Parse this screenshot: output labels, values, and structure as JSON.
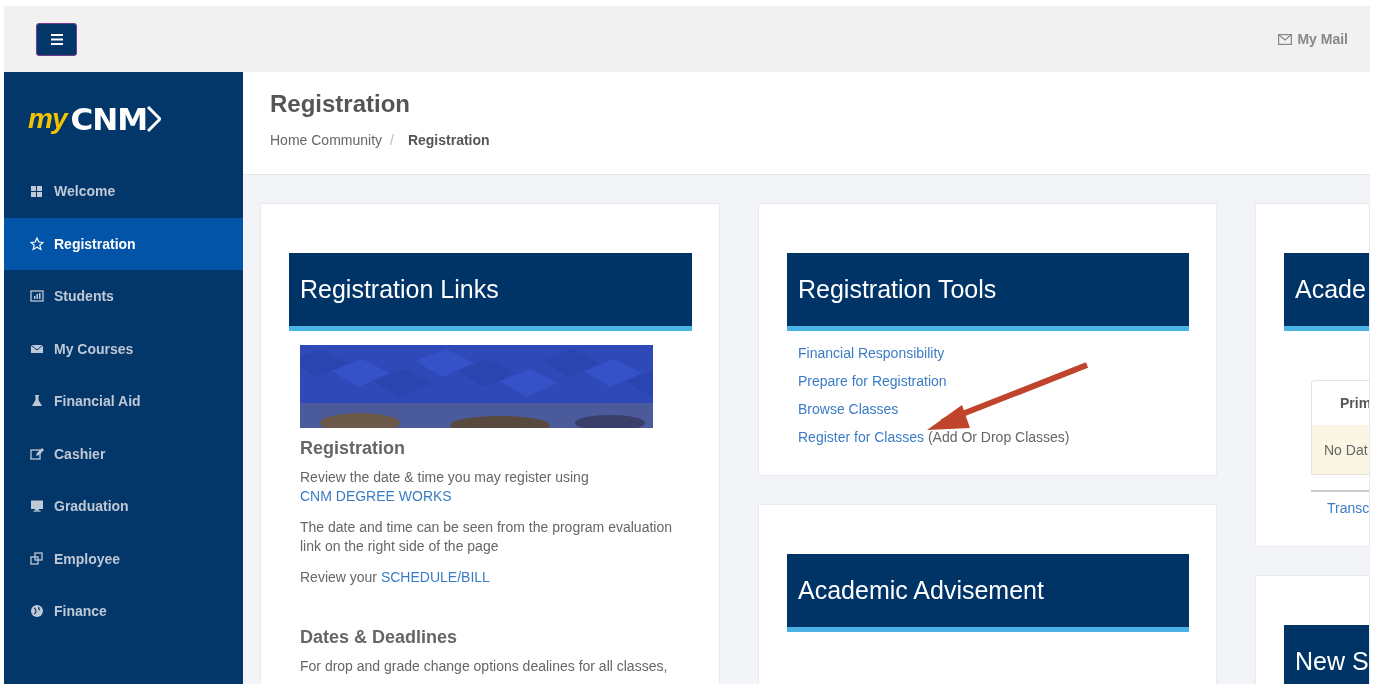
{
  "top_bar": {
    "mail_link": "My Mail"
  },
  "sidebar": {
    "logo": {
      "prefix": "my",
      "name": "CNM"
    },
    "items": [
      {
        "label": "Welcome",
        "selected": false
      },
      {
        "label": "Registration",
        "selected": true
      },
      {
        "label": "Students",
        "selected": false
      },
      {
        "label": "My Courses",
        "selected": false
      },
      {
        "label": "Financial Aid",
        "selected": false
      },
      {
        "label": "Cashier",
        "selected": false
      },
      {
        "label": "Graduation",
        "selected": false
      },
      {
        "label": "Employee",
        "selected": false
      },
      {
        "label": "Finance",
        "selected": false
      }
    ]
  },
  "page_header": {
    "title": "Registration",
    "breadcrumb": [
      {
        "label": "Home Community",
        "current": false,
        "separator": "/"
      },
      {
        "label": "Registration",
        "current": true
      }
    ]
  },
  "columns": [
    {
      "cards": [
        {
          "kind": "info",
          "title": "Registration Links",
          "banner": {
            "kind": "picture"
          },
          "sections": [
            {
              "heading": "Registration",
              "paragraphs": [
                [
                  {
                    "kind": "text",
                    "text": "Review the date & time you may register using "
                  },
                  {
                    "kind": "link",
                    "text": "CNM DEGREE WORKS"
                  }
                ],
                [
                  {
                    "kind": "text",
                    "text": "The date and time can be seen from the program evaluation link on the right side of the page"
                  }
                ],
                [
                  {
                    "kind": "text",
                    "text": "Review your "
                  },
                  {
                    "kind": "link",
                    "text": "SCHEDULE/BILL"
                  }
                ]
              ]
            },
            {
              "heading": "Dates & Deadlines",
              "paragraphs": [
                [
                  {
                    "kind": "text",
                    "text": "For drop and grade change options dealines for all classes,"
                  }
                ]
              ]
            }
          ]
        }
      ]
    },
    {
      "cards": [
        {
          "kind": "links",
          "title": "Registration Tools",
          "links": [
            {
              "label": "Financial Responsibility"
            },
            {
              "label": "Prepare for Registration"
            },
            {
              "label": "Browse Classes"
            },
            {
              "label": "Register for Classes",
              "note": "(Add Or Drop Classes)"
            }
          ]
        },
        {
          "kind": "title",
          "title": "Academic Advisement"
        }
      ]
    },
    {
      "cards": [
        {
          "kind": "table",
          "title": "Acade",
          "table": {
            "column_1": "Prim",
            "rows": [
              "No Dat"
            ],
            "link": "Transc"
          }
        },
        {
          "kind": "title",
          "title": "New S"
        }
      ]
    }
  ]
}
